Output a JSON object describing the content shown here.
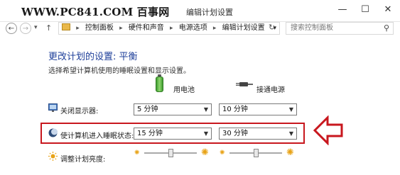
{
  "watermark": "WWW.PC841.COM 百事网",
  "window": {
    "title": "编辑计划设置",
    "controls": {
      "minimize": "—",
      "maximize": "☐",
      "close": "✕"
    }
  },
  "address": {
    "nav": {
      "back": "←",
      "forward": "→",
      "recent": "▾",
      "up": "↑"
    },
    "crumbs": [
      "控制面板",
      "硬件和声音",
      "电源选项",
      "编辑计划设置"
    ],
    "separator": "▸",
    "dropdown": "▾",
    "refresh": "↻",
    "search_placeholder": "搜索控制面板",
    "search_icon": "⚲"
  },
  "page": {
    "heading": "更改计划的设置: 平衡",
    "subtext": "选择希望计算机使用的睡眠设置和显示设置。"
  },
  "columns": {
    "battery": "用电池",
    "plugged": "接通电源"
  },
  "rows": [
    {
      "label": "关闭显示器:",
      "battery_value": "5 分钟",
      "plugged_value": "10 分钟",
      "icon": "monitor-icon"
    },
    {
      "label": "使计算机进入睡眠状态:",
      "battery_value": "15 分钟",
      "plugged_value": "30 分钟",
      "icon": "moon-icon"
    }
  ],
  "brightness": {
    "label": "调整计划亮度:",
    "battery_level": 0.5,
    "plugged_level": 0.5
  },
  "colors": {
    "accent": "#1e3f9a",
    "highlight": "#c8171e",
    "battery_green": "#3e9b2f",
    "sun": "#e8a317"
  }
}
